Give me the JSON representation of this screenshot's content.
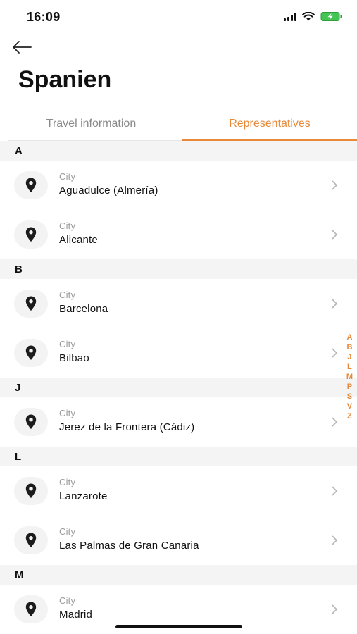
{
  "status_bar": {
    "time": "16:09"
  },
  "header": {
    "title": "Spanien"
  },
  "tabs": [
    {
      "label": "Travel information",
      "active": false
    },
    {
      "label": "Representatives",
      "active": true
    }
  ],
  "sections": [
    {
      "letter": "A",
      "items": [
        {
          "label": "City",
          "name": "Aguadulce (Almería)"
        },
        {
          "label": "City",
          "name": "Alicante"
        }
      ]
    },
    {
      "letter": "B",
      "items": [
        {
          "label": "City",
          "name": "Barcelona"
        },
        {
          "label": "City",
          "name": "Bilbao"
        }
      ]
    },
    {
      "letter": "J",
      "items": [
        {
          "label": "City",
          "name": "Jerez de la Frontera (Cádiz)"
        }
      ]
    },
    {
      "letter": "L",
      "items": [
        {
          "label": "City",
          "name": "Lanzarote"
        },
        {
          "label": "City",
          "name": "Las Palmas de Gran Canaria"
        }
      ]
    },
    {
      "letter": "M",
      "items": [
        {
          "label": "City",
          "name": "Madrid"
        }
      ]
    }
  ],
  "alphabet_index": [
    "A",
    "B",
    "J",
    "L",
    "M",
    "P",
    "S",
    "V",
    "Z"
  ],
  "colors": {
    "accent": "#e8893a",
    "section_bg": "#f4f4f4",
    "muted_text": "#9c9c9c"
  }
}
